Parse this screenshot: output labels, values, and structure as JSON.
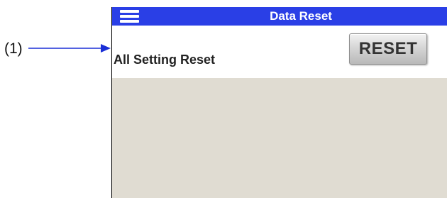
{
  "callout": {
    "label": "(1)"
  },
  "header": {
    "title": "Data Reset",
    "menu_icon": "hamburger-menu-icon",
    "background_color": "#2a3fe6"
  },
  "setting": {
    "label": "All Setting Reset",
    "button_label": "RESET"
  },
  "colors": {
    "content_background": "#e0dcd2",
    "row_background": "#ffffff",
    "arrow": "#1a2fd6"
  }
}
